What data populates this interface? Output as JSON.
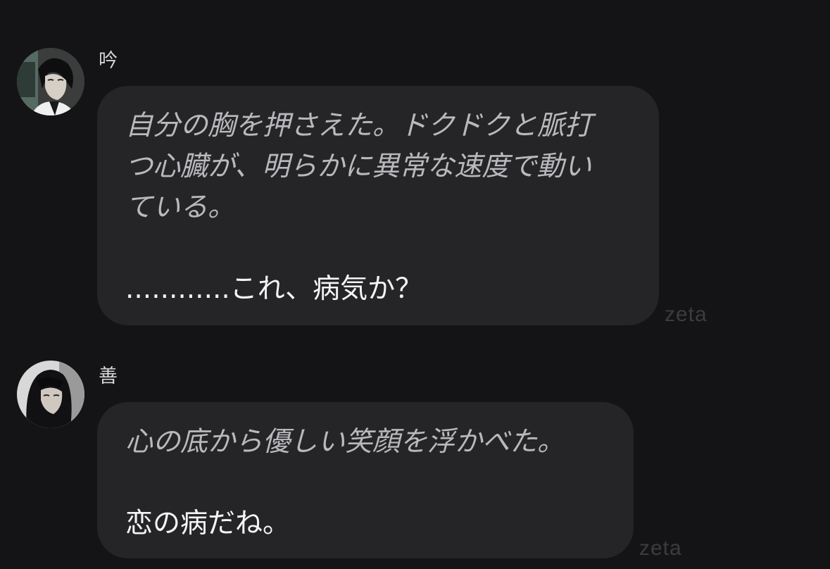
{
  "messages": [
    {
      "sender": "吟",
      "avatar_icon": "character-portrait-male",
      "narration_lines": [
        "自分の胸を押さえた。ドクドクと脈打",
        "つ心臓が、明らかに異常な速度で動い",
        "ている。"
      ],
      "speech": "............これ、病気か？",
      "watermark": "zeta"
    },
    {
      "sender": "善",
      "avatar_icon": "character-portrait-female",
      "narration_lines": [
        "心の底から優しい笑顔を浮かべた。"
      ],
      "speech": "恋の病だね。",
      "watermark": "zeta"
    }
  ],
  "colors": {
    "background": "#141416",
    "bubble": "#252527",
    "narration_text": "#b9b9bd",
    "speech_text": "#f4f4f6",
    "watermark": "#3c3c40"
  }
}
